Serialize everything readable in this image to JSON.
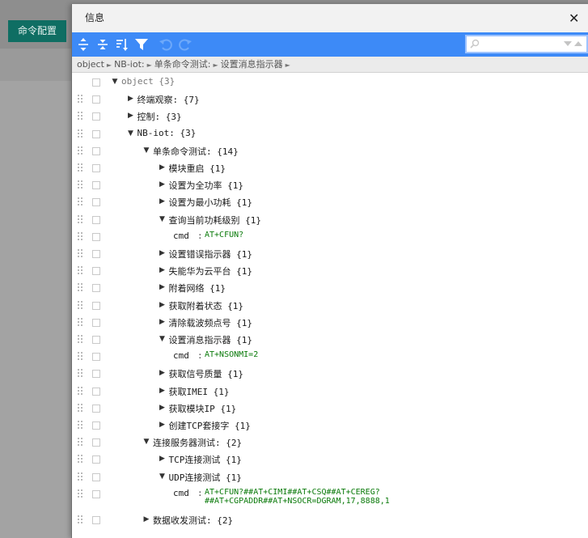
{
  "background": {
    "tab_label": "命令配置"
  },
  "dialog": {
    "title": "信息",
    "close_symbol": "✕"
  },
  "menubar": {
    "buttons": [
      "expand-all",
      "collapse-all",
      "sort",
      "filter",
      "undo",
      "redo"
    ],
    "search_placeholder": ""
  },
  "navbar": {
    "path": [
      "object",
      "NB-iot:",
      "单条命令测试:",
      "设置消息指示器"
    ],
    "separator": "►"
  },
  "tree": {
    "nodes": [
      {
        "level": 0,
        "key": "object",
        "count": "{3}",
        "expanded": true,
        "root": true
      },
      {
        "level": 1,
        "key": "终端观察:",
        "count": "{7}",
        "expanded": false
      },
      {
        "level": 1,
        "key": "控制:",
        "count": "{3}",
        "expanded": false
      },
      {
        "level": 1,
        "key": "NB-iot:",
        "count": "{3}",
        "expanded": true
      },
      {
        "level": 2,
        "key": "单条命令测试:",
        "count": "{14}",
        "expanded": true
      },
      {
        "level": 3,
        "key": "模块重启",
        "count": "{1}",
        "expanded": false
      },
      {
        "level": 3,
        "key": "设置为全功率",
        "count": "{1}",
        "expanded": false
      },
      {
        "level": 3,
        "key": "设置为最小功耗",
        "count": "{1}",
        "expanded": false
      },
      {
        "level": 3,
        "key": "查询当前功耗级别",
        "count": "{1}",
        "expanded": true
      },
      {
        "level": 4,
        "key": "cmd",
        "value": "AT+CFUN?"
      },
      {
        "level": 3,
        "key": "设置错误指示器",
        "count": "{1}",
        "expanded": false
      },
      {
        "level": 3,
        "key": "失能华为云平台",
        "count": "{1}",
        "expanded": false
      },
      {
        "level": 3,
        "key": "附着网络",
        "count": "{1}",
        "expanded": false
      },
      {
        "level": 3,
        "key": "获取附着状态",
        "count": "{1}",
        "expanded": false
      },
      {
        "level": 3,
        "key": "清除载波频点号",
        "count": "{1}",
        "expanded": false
      },
      {
        "level": 3,
        "key": "设置消息指示器",
        "count": "{1}",
        "expanded": true
      },
      {
        "level": 4,
        "key": "cmd",
        "value": "AT+NSONMI=2"
      },
      {
        "level": 3,
        "key": "获取信号质量",
        "count": "{1}",
        "expanded": false
      },
      {
        "level": 3,
        "key": "获取IMEI",
        "count": "{1}",
        "expanded": false
      },
      {
        "level": 3,
        "key": "获取模块IP",
        "count": "{1}",
        "expanded": false
      },
      {
        "level": 3,
        "key": "创建TCP套接字",
        "count": "{1}",
        "expanded": false
      },
      {
        "level": 2,
        "key": "连接服务器测试:",
        "count": "{2}",
        "expanded": true
      },
      {
        "level": 3,
        "key": "TCP连接测试",
        "count": "{1}",
        "expanded": false
      },
      {
        "level": 3,
        "key": "UDP连接测试",
        "count": "{1}",
        "expanded": true
      },
      {
        "level": 4,
        "key": "cmd",
        "value": "AT+CFUN?##AT+CIMI##AT+CSQ##AT+CEREG?\n##AT+CGPADDR##AT+NSOCR=DGRAM,17,8888,1",
        "multiline": true
      },
      {
        "level": 2,
        "key": "数据收发测试:",
        "count": "{2}",
        "expanded": false
      }
    ]
  },
  "colors": {
    "menubar": "#3d8af7",
    "value_text": "#0a7a0a",
    "tab_bg": "#0f6e63"
  }
}
